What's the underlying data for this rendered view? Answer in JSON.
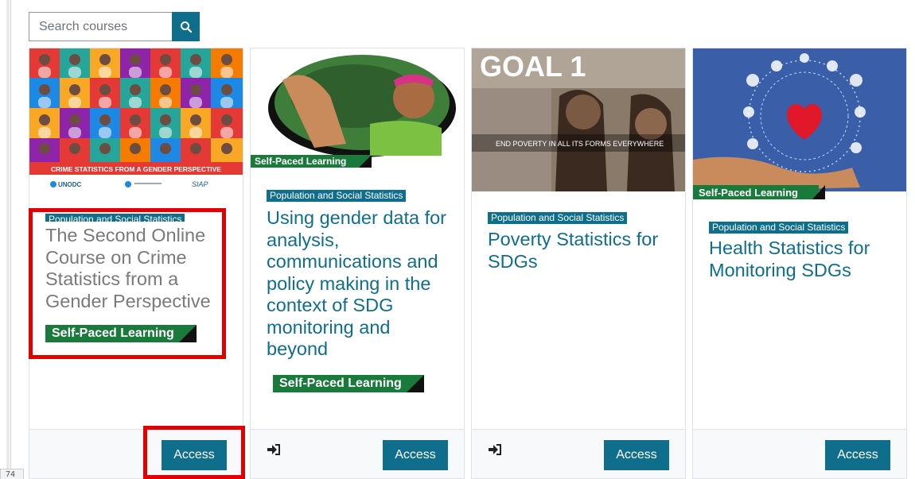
{
  "search": {
    "placeholder": "Search courses"
  },
  "zoom_indicator": "74",
  "courses": [
    {
      "category": "Population and Social Statistics",
      "title": "The Second Online Course on Crime Statistics from a Gender Perspective",
      "badge": "Self-Paced Learning",
      "banner_text": "CRIME STATISTICS FROM A GENDER PERSPECTIVE",
      "logos": [
        "UNODC",
        "SIAP"
      ],
      "access_label": "Access"
    },
    {
      "category": "Population and Social Statistics",
      "title": "Using gender data for analysis, communications and policy making in the context of SDG monitoring and beyond",
      "badge_image": "Self-Paced Learning",
      "badge": "Self-Paced Learning",
      "access_label": "Access"
    },
    {
      "category": "Population and Social Statistics",
      "title": "Poverty Statistics for SDGs",
      "image_heading": "GOAL 1",
      "image_caption": "END POVERTY IN ALL ITS FORMS EVERYWHERE",
      "access_label": "Access"
    },
    {
      "category": "Population and Social Statistics",
      "title": "Health Statistics for Monitoring SDGs",
      "badge_image": "Self-Paced Learning",
      "access_label": "Access"
    }
  ],
  "colors": {
    "accent": "#0f6e8c",
    "badge_green": "#1a7a3c",
    "highlight_red": "#e30000"
  },
  "icons": [
    "search-icon",
    "enter-icon"
  ]
}
